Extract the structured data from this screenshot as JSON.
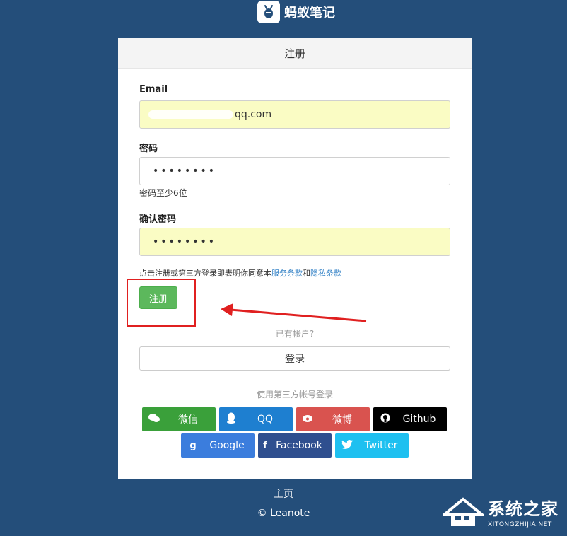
{
  "brand": {
    "name": "蚂蚁笔记"
  },
  "card": {
    "title": "注册"
  },
  "form": {
    "email_label": "Email",
    "email_value": "qq.com",
    "password_label": "密码",
    "password_value": "••••••••",
    "password_hint": "密码至少6位",
    "confirm_label": "确认密码",
    "confirm_value": "••••••••",
    "agree_prefix": "点击注册或第三方登录即表明你同意本",
    "terms_link": "服务条款",
    "agree_and": "和",
    "privacy_link": "隐私条款",
    "register_button": "注册"
  },
  "account": {
    "have_account": "已有帐户?",
    "login_button": "登录",
    "third_party_text": "使用第三方帐号登录"
  },
  "social": [
    {
      "name": "wechat",
      "label": "微信",
      "icon": "wechat-icon",
      "color": "#3aa03a"
    },
    {
      "name": "qq",
      "label": "QQ",
      "icon": "qq-icon",
      "color": "#1e7fd0"
    },
    {
      "name": "weibo",
      "label": "微博",
      "icon": "weibo-icon",
      "color": "#d9534f"
    },
    {
      "name": "github",
      "label": "Github",
      "icon": "github-icon",
      "color": "#000000"
    },
    {
      "name": "google",
      "label": "Google",
      "icon": "google-icon",
      "color": "#3b7ddd"
    },
    {
      "name": "facebook",
      "label": "Facebook",
      "icon": "facebook-icon",
      "color": "#2f4f8f"
    },
    {
      "name": "twitter",
      "label": "Twitter",
      "icon": "twitter-icon",
      "color": "#1ec0f0"
    }
  ],
  "footer": {
    "home": "主页",
    "copyright": "© Leanote"
  },
  "watermark": {
    "cn": "系统之家",
    "en": "XITONGZHIJIA.NET"
  },
  "colors": {
    "background": "#244e7a",
    "register": "#5cb85c",
    "highlight": "#e02020",
    "autofill": "#fafcc4"
  }
}
